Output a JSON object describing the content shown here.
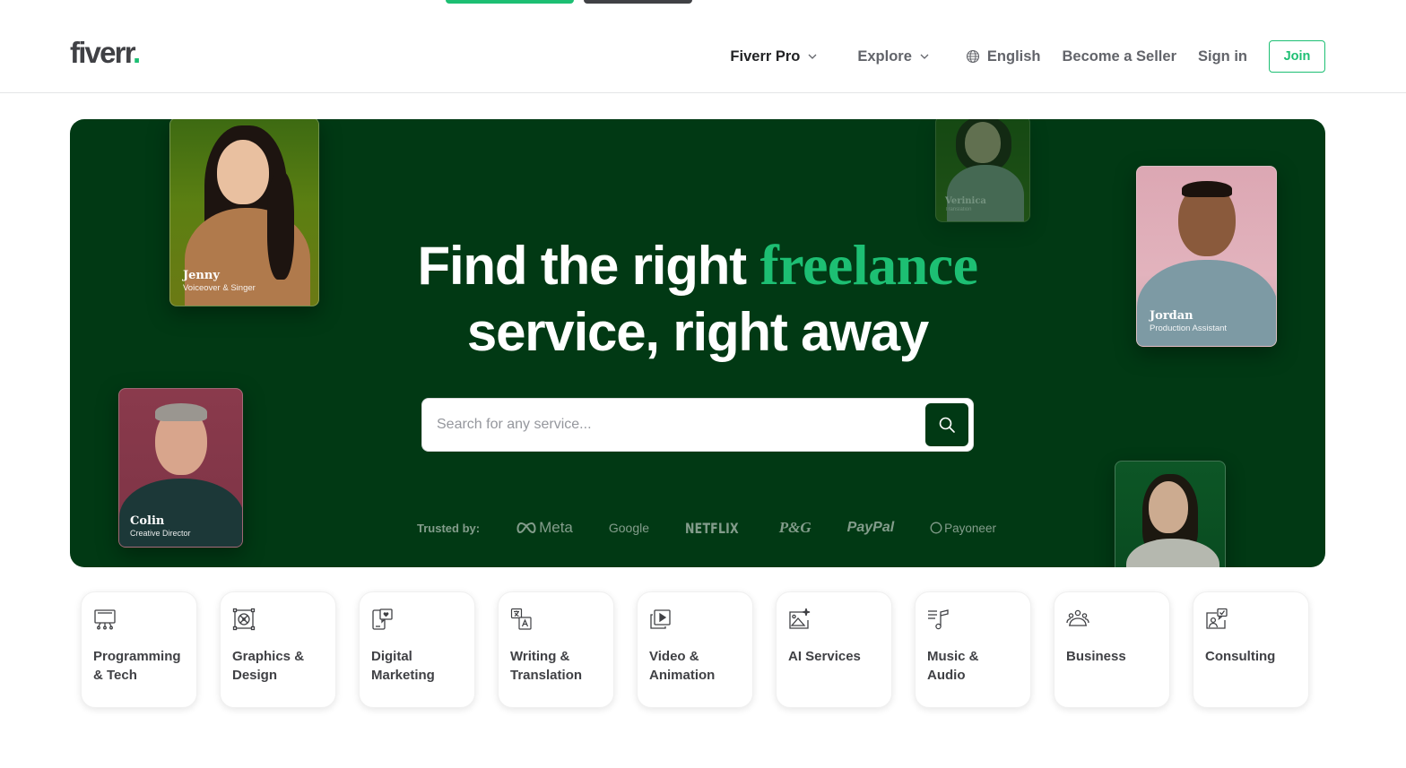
{
  "header": {
    "logo": {
      "text": "fiverr",
      "dot": "."
    },
    "nav": {
      "fiverr_pro": "Fiverr Pro",
      "explore": "Explore",
      "language": "English",
      "become_seller": "Become a Seller",
      "sign_in": "Sign in",
      "join": "Join"
    }
  },
  "hero": {
    "headline_line1_prefix": "Find the right ",
    "headline_accent": "freelance",
    "headline_line2": "service, right away",
    "search": {
      "placeholder": "Search for any service...",
      "value": ""
    },
    "trusted_label": "Trusted by:",
    "trusted_logos": [
      "Meta",
      "Google",
      "NETFLIX",
      "P&G",
      "PayPal",
      "Payoneer"
    ],
    "freelancers": [
      {
        "name": "Jenny",
        "role": "Voiceover & Singer"
      },
      {
        "name": "Verinica",
        "role": "Translation"
      },
      {
        "name": "Jordan",
        "role": "Production Assistant"
      },
      {
        "name": "Colin",
        "role": "Creative Director"
      },
      {
        "name": "",
        "role": ""
      }
    ]
  },
  "categories": [
    {
      "label": "Programming & Tech",
      "icon": "monitor-code-icon"
    },
    {
      "label": "Graphics & Design",
      "icon": "vector-design-icon"
    },
    {
      "label": "Digital Marketing",
      "icon": "phone-heart-icon"
    },
    {
      "label": "Writing & Translation",
      "icon": "translate-icon"
    },
    {
      "label": "Video & Animation",
      "icon": "video-play-icon"
    },
    {
      "label": "AI Services",
      "icon": "ai-image-icon"
    },
    {
      "label": "Music & Audio",
      "icon": "music-note-icon"
    },
    {
      "label": "Business",
      "icon": "people-group-icon"
    },
    {
      "label": "Consulting",
      "icon": "consulting-chat-icon"
    }
  ],
  "colors": {
    "brand_green": "#1dbf73",
    "hero_bg": "#013914",
    "text_dark": "#404145"
  }
}
